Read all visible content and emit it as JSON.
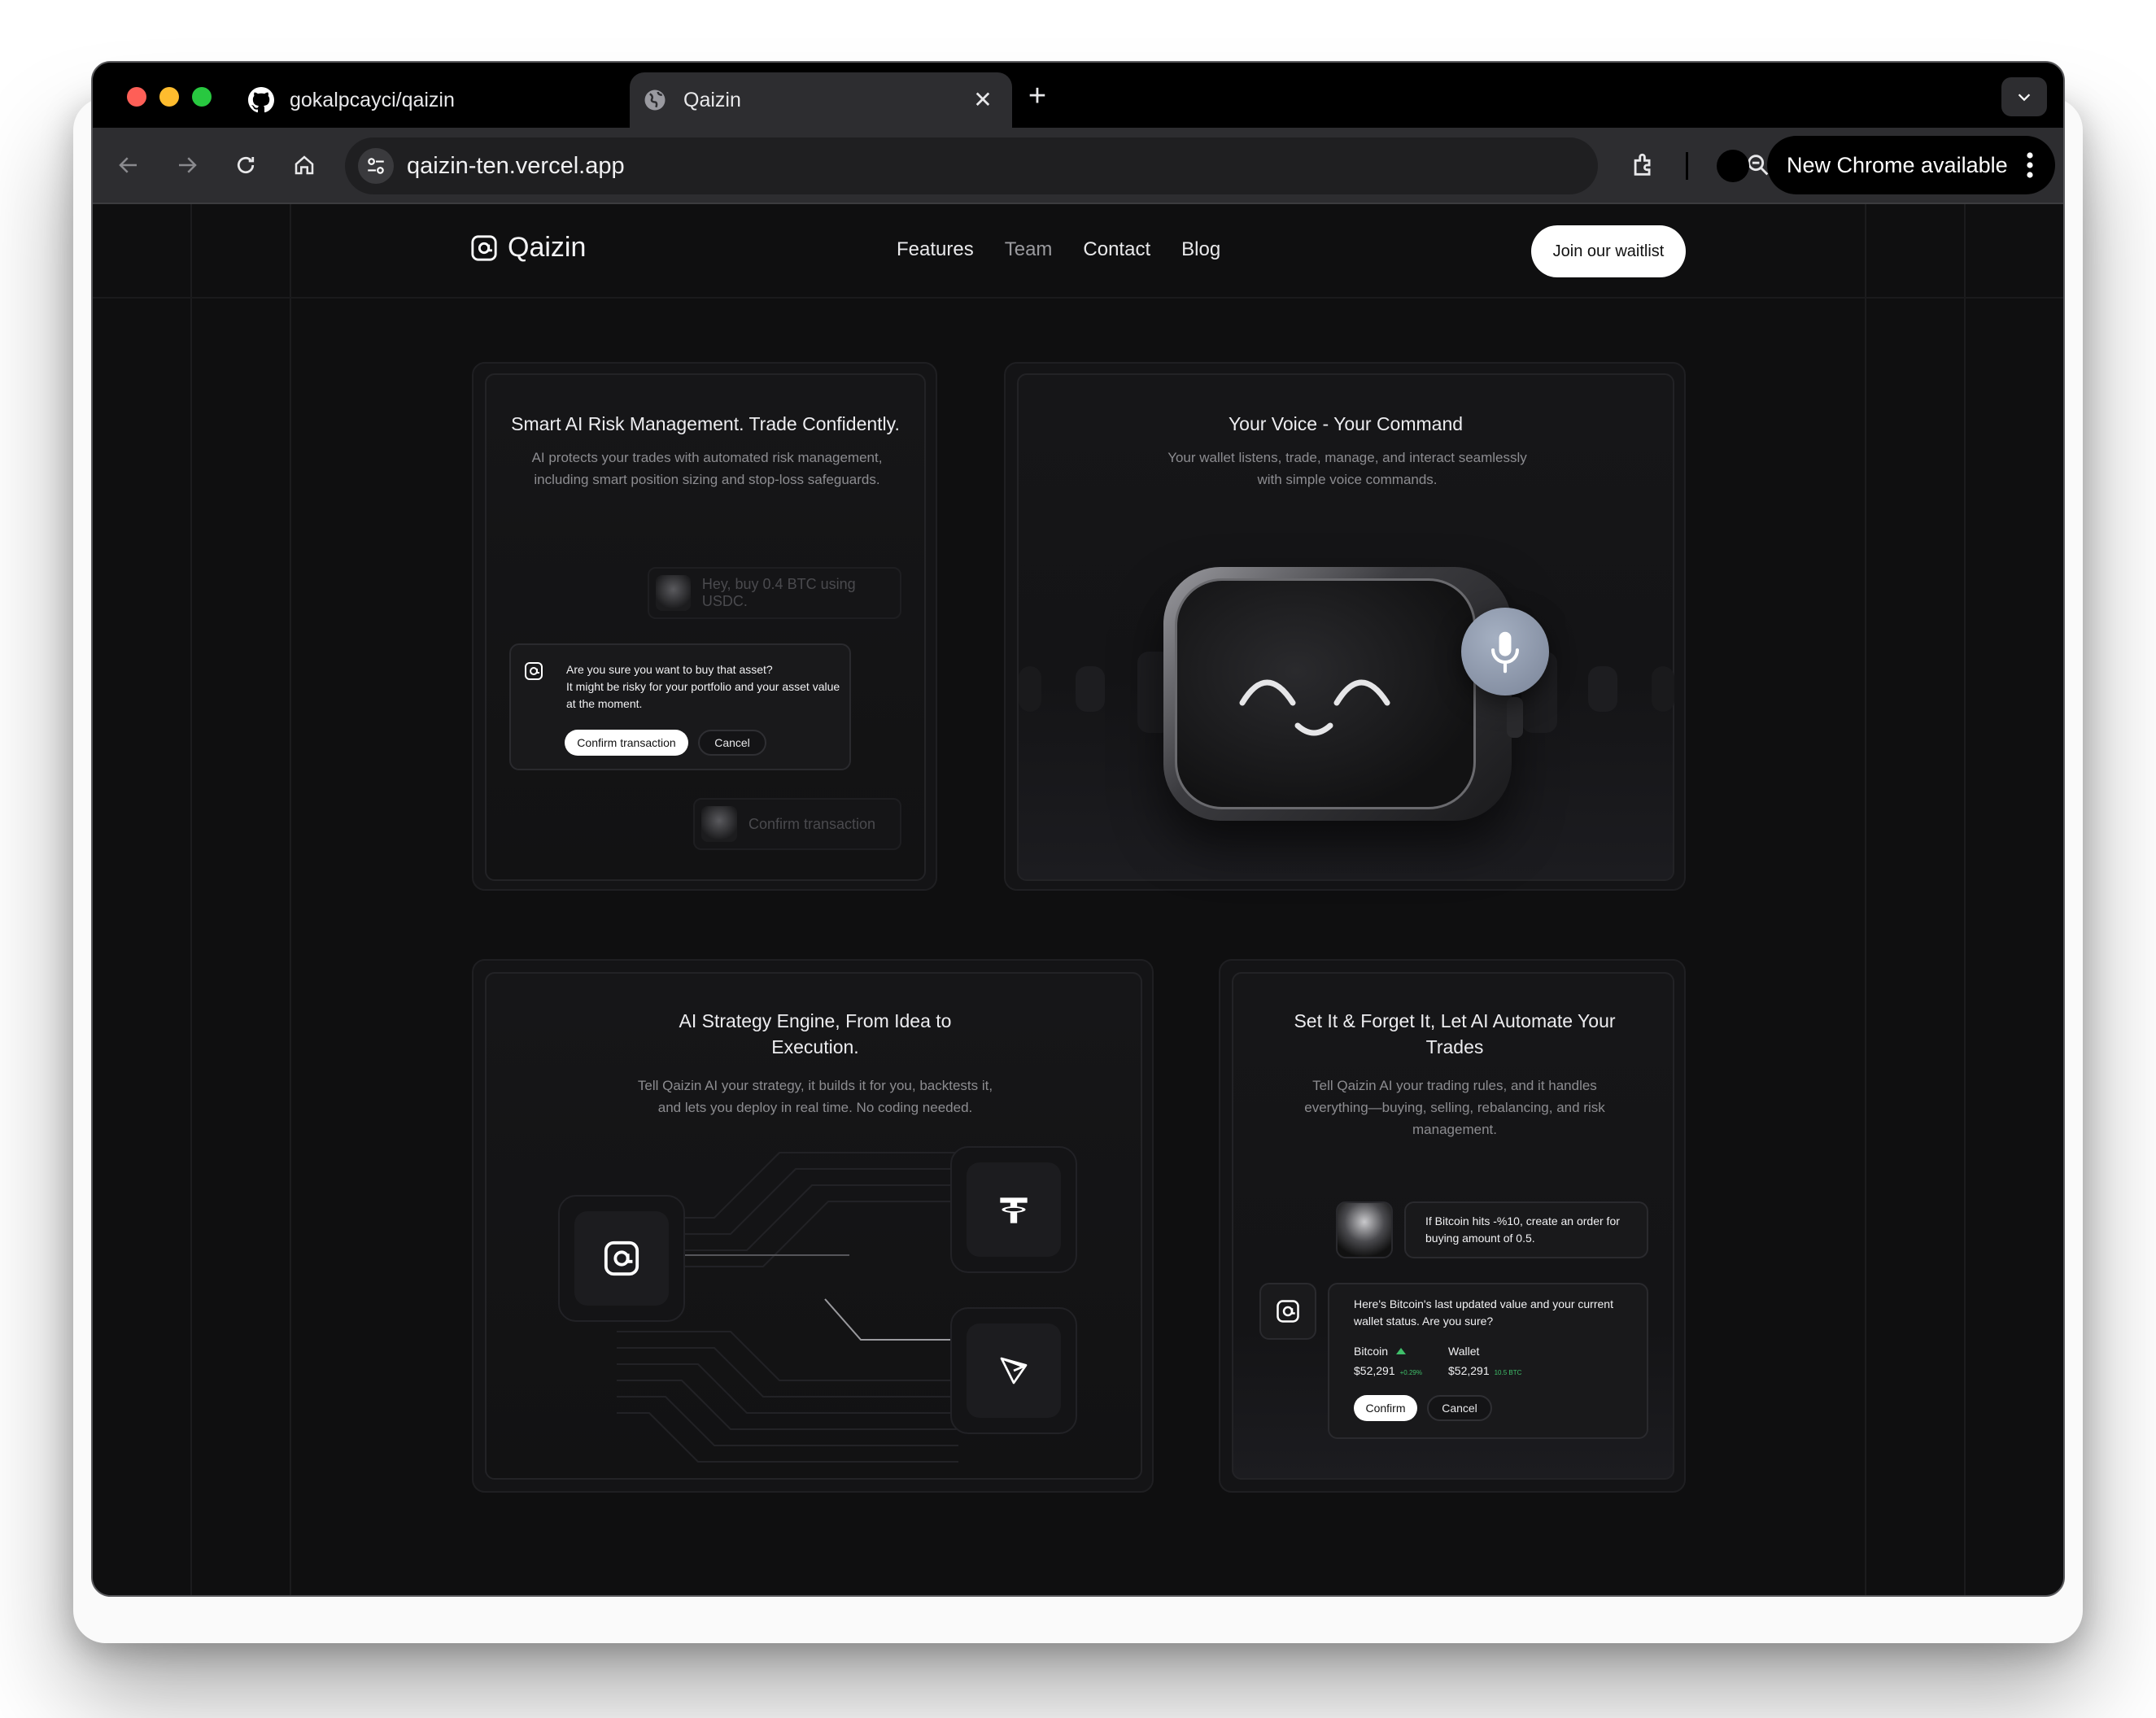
{
  "browser": {
    "tabs": [
      {
        "title": "gokalpcayci/qaizin",
        "icon": "github-icon"
      },
      {
        "title": "Qaizin",
        "icon": "globe-icon"
      }
    ],
    "url": "qaizin-ten.vercel.app",
    "update_label": "New Chrome available"
  },
  "site": {
    "brand": "Qaizin",
    "nav": [
      "Features",
      "Team",
      "Contact",
      "Blog"
    ],
    "cta": "Join our waitlist"
  },
  "cards": {
    "risk": {
      "title": "Smart AI Risk Management. Trade Confidently.",
      "desc": "AI protects your trades with automated risk management, including smart position sizing and stop-loss safeguards.",
      "user_msg": "Hey, buy 0.4 BTC using USDC.",
      "ai_question": "Are you sure you want to buy that asset?",
      "ai_warning": "It might be risky for your portfolio and your asset value at the moment.",
      "confirm": "Confirm transaction",
      "cancel": "Cancel",
      "user_reply": "Confirm transaction"
    },
    "voice": {
      "title": "Your Voice - Your Command",
      "desc": "Your wallet listens, trade, manage, and interact seamlessly with simple voice commands."
    },
    "strategy": {
      "title": "AI Strategy Engine, From Idea to Execution.",
      "desc": "Tell Qaizin AI your strategy, it builds it for you, backtests it, and lets you deploy in real time. No coding needed."
    },
    "automate": {
      "title": "Set It & Forget It, Let AI Automate Your Trades",
      "desc": "Tell Qaizin AI your trading rules, and it handles everything—buying, selling, rebalancing, and risk management.",
      "user_msg": "If Bitcoin hits -%10, create an order for buying amount of 0.5.",
      "ai_msg": "Here's Bitcoin's last updated value and your current wallet status. Are you sure?",
      "bitcoin_label": "Bitcoin",
      "bitcoin_value": "$52,291",
      "bitcoin_change": "+0.29%",
      "wallet_label": "Wallet",
      "wallet_value": "$52,291",
      "wallet_btc": "10.5 BTC",
      "confirm": "Confirm",
      "cancel": "Cancel"
    }
  },
  "colors": {
    "accent_green": "#3fbf6a",
    "mic_bubble": "#8a95a8"
  }
}
